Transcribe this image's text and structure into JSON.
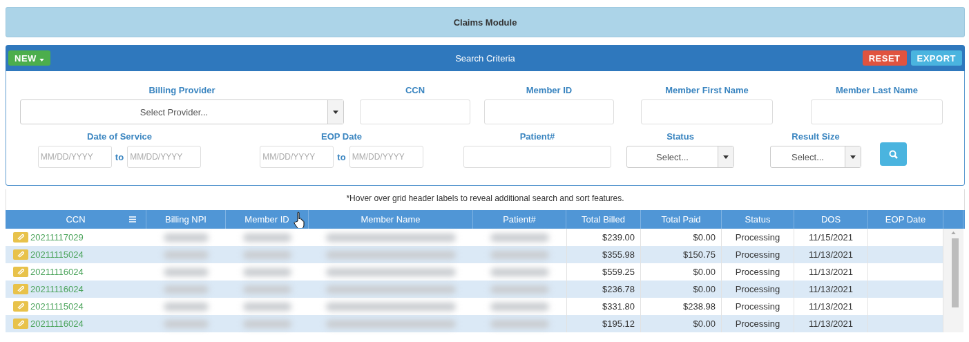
{
  "title": "Claims Module",
  "search_bar": {
    "new_button": "NEW",
    "title": "Search Criteria",
    "reset_button": "RESET",
    "export_button": "EXPORT"
  },
  "form_rows": [
    [
      {
        "kind": "select",
        "label": "Billing Provider",
        "placeholder": "Select Provider..."
      },
      {
        "kind": "text",
        "label": "CCN"
      },
      {
        "kind": "text",
        "label": "Member ID"
      },
      {
        "kind": "text",
        "label": "Member First Name"
      },
      {
        "kind": "text",
        "label": "Member Last Name"
      }
    ],
    [
      {
        "kind": "daterange",
        "label": "Date of Service",
        "placeholder": "MM/DD/YYYY",
        "separator": "to",
        "placeholder_to": "MM/DD/YYYY"
      },
      {
        "kind": "daterange",
        "label": "EOP Date",
        "placeholder": "MM/DD/YYYY",
        "separator": "to",
        "placeholder_to": "MM/DD/YYYY"
      },
      {
        "kind": "text",
        "label": "Patient#"
      },
      {
        "kind": "select",
        "label": "Status",
        "placeholder": "Select..."
      },
      {
        "kind": "select",
        "label": "Result Size",
        "placeholder": "Select..."
      },
      {
        "kind": "search"
      }
    ]
  ],
  "hint": "*Hover over grid header labels to reveal additional search and sort features.",
  "table": {
    "columns": [
      "CCN",
      "Billing NPI",
      "Member ID",
      "Member Name",
      "Patient#",
      "Total Billed",
      "Total Paid",
      "Status",
      "DOS",
      "EOP Date"
    ],
    "rows": [
      {
        "ccn": "20211117029",
        "total_billed": "$239.00",
        "total_paid": "$0.00",
        "status": "Processing",
        "dos": "11/15/2021"
      },
      {
        "ccn": "20211115024",
        "total_billed": "$355.98",
        "total_paid": "$150.75",
        "status": "Processing",
        "dos": "11/13/2021"
      },
      {
        "ccn": "20211116024",
        "total_billed": "$559.25",
        "total_paid": "$0.00",
        "status": "Processing",
        "dos": "11/13/2021"
      },
      {
        "ccn": "20211116024",
        "total_billed": "$236.78",
        "total_paid": "$0.00",
        "status": "Processing",
        "dos": "11/13/2021"
      },
      {
        "ccn": "20211115024",
        "total_billed": "$331.80",
        "total_paid": "$238.98",
        "status": "Processing",
        "dos": "11/13/2021"
      },
      {
        "ccn": "20211116024",
        "total_billed": "$195.12",
        "total_paid": "$0.00",
        "status": "Processing",
        "dos": "11/13/2021"
      }
    ]
  }
}
